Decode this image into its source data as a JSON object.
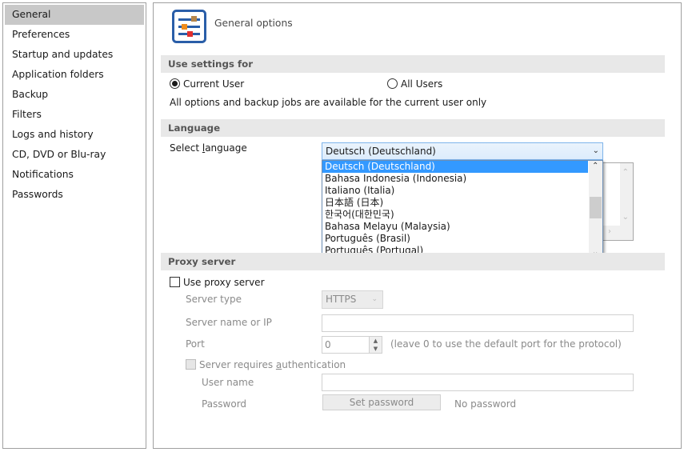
{
  "sidebar": {
    "items": [
      {
        "label": "General",
        "selected": true
      },
      {
        "label": "Preferences"
      },
      {
        "label": "Startup and updates"
      },
      {
        "label": "Application folders"
      },
      {
        "label": "Backup"
      },
      {
        "label": "Filters"
      },
      {
        "label": "Logs and history"
      },
      {
        "label": "CD, DVD or Blu-ray"
      },
      {
        "label": "Notifications"
      },
      {
        "label": "Passwords"
      }
    ]
  },
  "header": {
    "title": "General options",
    "icon": "sliders-settings-icon"
  },
  "use_settings": {
    "section_label": "Use settings for",
    "option_current": "Current User",
    "option_all": "All Users",
    "selected": "Current User",
    "note": "All options and backup jobs are available for the current user only"
  },
  "language": {
    "section_label": "Language",
    "select_label_pre": "Select ",
    "select_label_u": "l",
    "select_label_post": "anguage",
    "selected": "Deutsch (Deutschland)",
    "options": [
      "Deutsch (Deutschland)",
      "Bahasa Indonesia (Indonesia)",
      "Italiano (Italia)",
      "日本語 (日本)",
      "한국어(대한민국)",
      "Bahasa Melayu (Malaysia)",
      "Português (Brasil)",
      "Português (Portugal)"
    ]
  },
  "proxy": {
    "section_label": "Proxy server",
    "use_proxy_label": "Use proxy server",
    "use_proxy_checked": false,
    "server_type_label": "Server type",
    "server_type_value": "HTTPS",
    "server_name_label": "Server name or IP",
    "server_name_value": "",
    "port_label": "Port",
    "port_value": "0",
    "port_hint": "(leave 0 to use the default port for the protocol)",
    "auth_label_pre": "Server requires ",
    "auth_label_u": "a",
    "auth_label_post": "uthentication",
    "auth_checked": false,
    "user_name_label": "User name",
    "user_name_value": "",
    "password_label": "Password",
    "set_password_button": "Set password",
    "password_status": "No password"
  },
  "colors": {
    "selection": "#3399ff",
    "sidebar_selected": "#c8c8c8",
    "section_bar": "#e8e8e8",
    "icon_blue": "#2a5ea8",
    "icon_brown": "#b5854a",
    "icon_orange": "#f08c1a",
    "icon_red": "#e03030"
  }
}
